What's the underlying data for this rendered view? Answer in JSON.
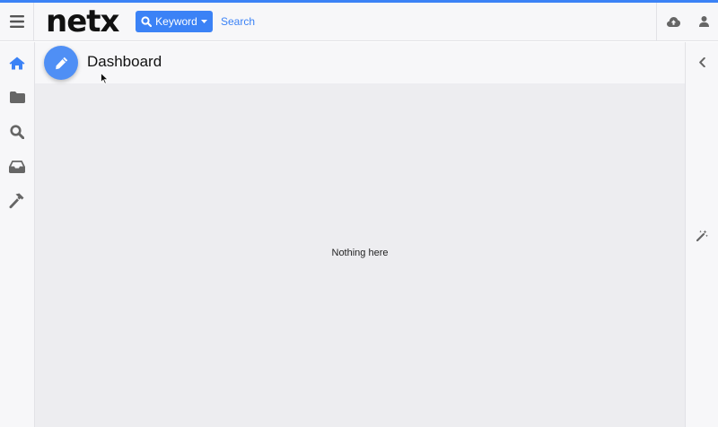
{
  "colors": {
    "accent": "#3b82f6",
    "fab": "#4f8ff5",
    "icon_gray": "#666666"
  },
  "header": {
    "logo_text": "netx",
    "search_type_label": "Keyword",
    "search_placeholder": "Search",
    "icons": [
      "menu-icon",
      "search-icon",
      "caret-down-icon",
      "cloud-upload-icon",
      "user-icon"
    ]
  },
  "sidebar": {
    "items": [
      {
        "icon": "home-icon",
        "active": true
      },
      {
        "icon": "folder-icon",
        "active": false
      },
      {
        "icon": "search-icon",
        "active": false
      },
      {
        "icon": "inbox-icon",
        "active": false
      },
      {
        "icon": "hammer-icon",
        "active": false
      }
    ]
  },
  "main": {
    "title": "Dashboard",
    "edit_icon": "pencil-icon",
    "empty_message": "Nothing here"
  },
  "right_panel": {
    "icons": [
      "chevron-left-icon",
      "magic-wand-icon"
    ]
  }
}
